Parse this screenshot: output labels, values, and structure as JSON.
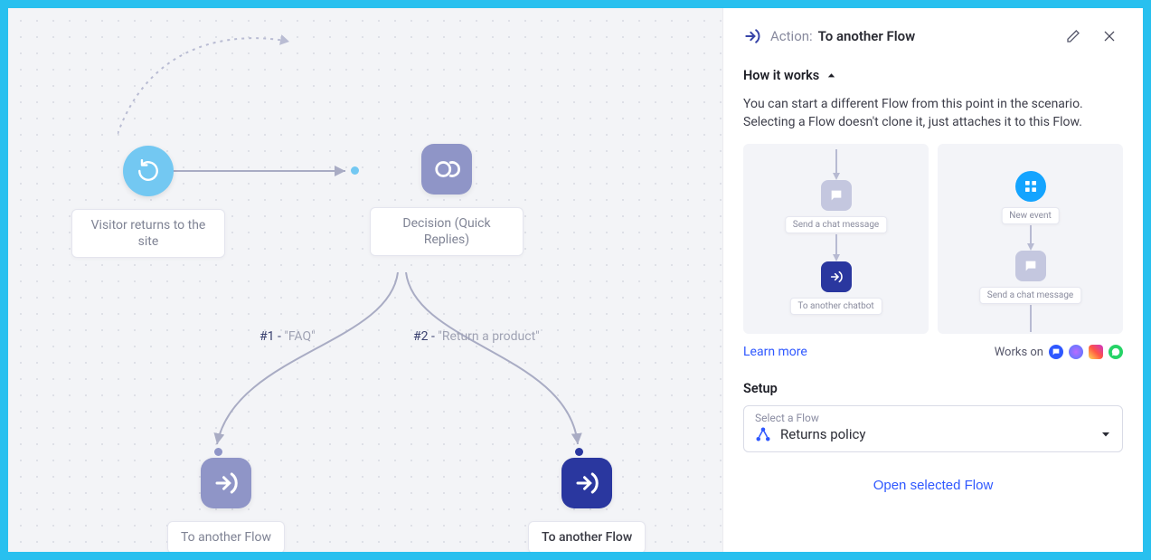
{
  "canvas": {
    "start": {
      "label": "Visitor returns to the site"
    },
    "decision": {
      "label": "Decision (Quick Replies)"
    },
    "branches": [
      {
        "prefix": "#1",
        "text": "FAQ"
      },
      {
        "prefix": "#2",
        "text": "Return a product"
      }
    ],
    "flowA": {
      "label": "To another Flow"
    },
    "flowB": {
      "label": "To another Flow"
    }
  },
  "panel": {
    "action_prefix": "Action:",
    "action_name": "To another Flow",
    "how_it_works": "How it works",
    "description": "You can start a different Flow from this point in the scenario. Selecting a Flow doesn't clone it, just attaches it to this Flow.",
    "mini": {
      "send_chat": "Send a chat message",
      "to_another_chatbot": "To another chatbot",
      "new_event": "New event"
    },
    "learn_more": "Learn more",
    "works_on": "Works on",
    "setup": "Setup",
    "select_label": "Select a Flow",
    "selected_flow": "Returns policy",
    "open_flow": "Open selected Flow"
  },
  "colors": {
    "light_blue": "#73c8f2",
    "lavender": "#8f95c7",
    "indigo": "#2a379f",
    "chat_sq": "#c4c7df",
    "blue_circle": "#14a4ff"
  }
}
